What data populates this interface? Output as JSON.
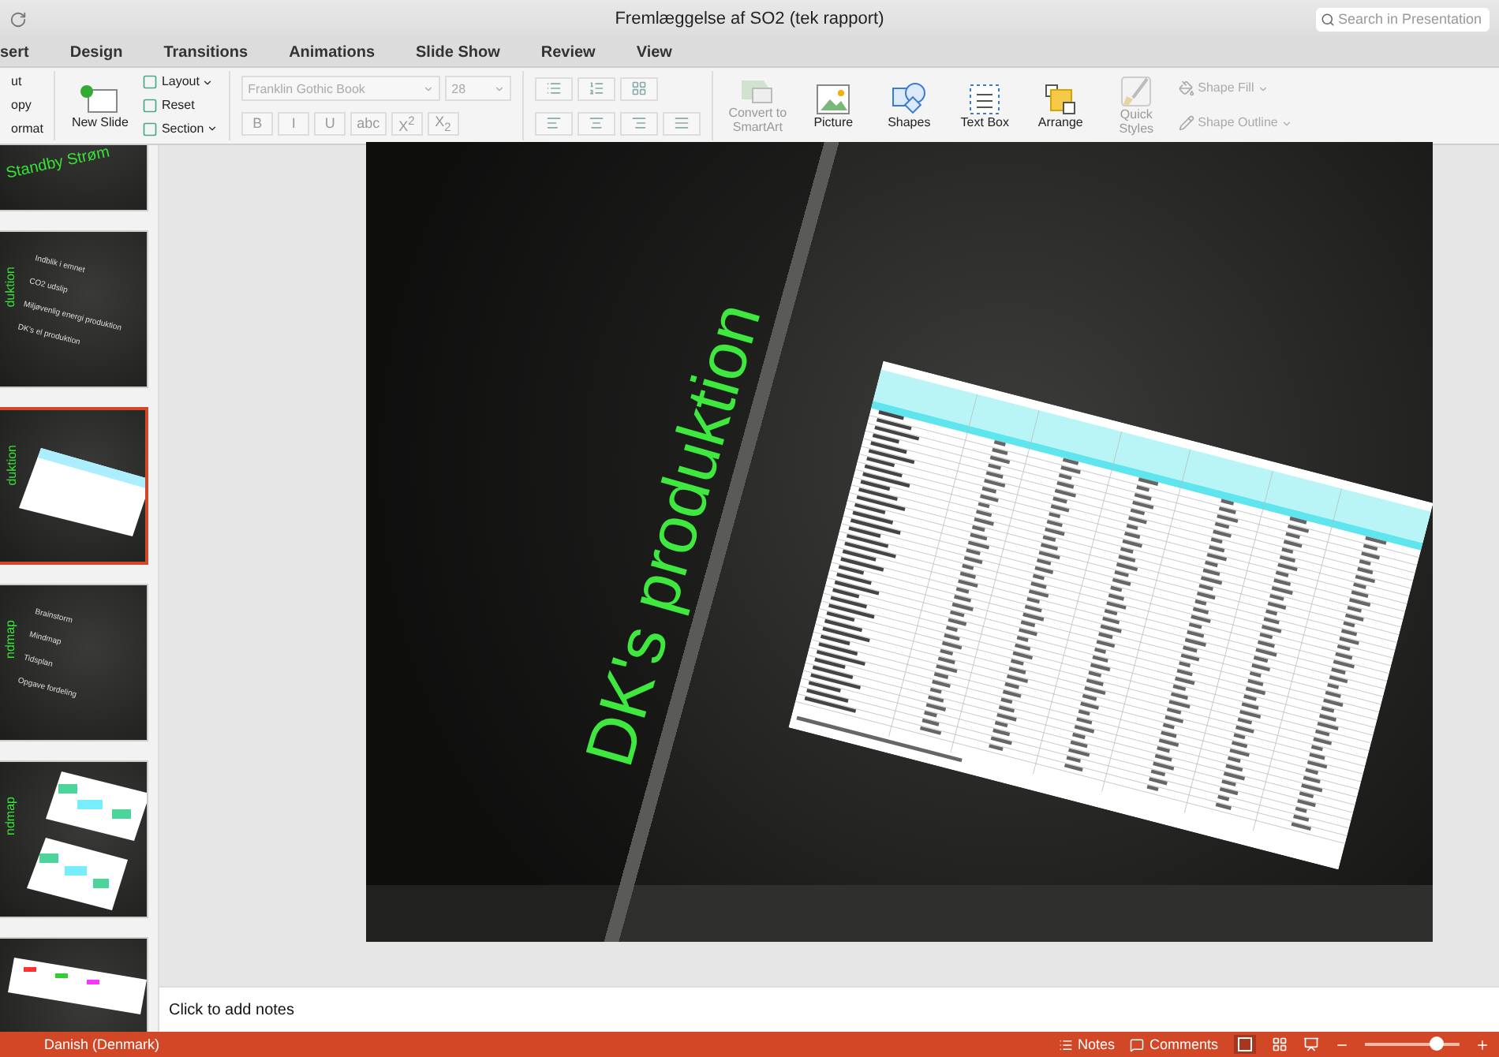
{
  "window": {
    "title": "Fremlæggelse af SO2 (tek rapport)",
    "search_placeholder": "Search in Presentation"
  },
  "tabs": [
    {
      "label": "sert"
    },
    {
      "label": "Design"
    },
    {
      "label": "Transitions"
    },
    {
      "label": "Animations"
    },
    {
      "label": "Slide Show"
    },
    {
      "label": "Review"
    },
    {
      "label": "View"
    }
  ],
  "ribbon": {
    "clipboard": [
      "ut",
      "opy",
      "ormat"
    ],
    "new_slide": "New Slide",
    "slide_commands": [
      {
        "label": "Layout",
        "menu": true
      },
      {
        "label": "Reset",
        "menu": false
      },
      {
        "label": "Section",
        "menu": true
      }
    ],
    "font_name": "Franklin Gothic Book",
    "font_size": "28",
    "format_buttons": [
      "B",
      "I",
      "U",
      "abc",
      "X$^{2}$",
      "X$_{2}$"
    ],
    "insert_buttons": [
      {
        "label": "Convert to SmartArt",
        "kind": "smartart",
        "disabled": true
      },
      {
        "label": "Picture",
        "kind": "picture",
        "disabled": false
      },
      {
        "label": "Shapes",
        "kind": "shapes",
        "disabled": false
      },
      {
        "label": "Text Box",
        "kind": "textbox",
        "disabled": false
      },
      {
        "label": "Arrange",
        "kind": "arrange",
        "disabled": false
      },
      {
        "label": "Quick Styles",
        "kind": "styles",
        "disabled": true
      }
    ],
    "shape_commands": [
      {
        "label": "Shape Fill",
        "kind": "fill"
      },
      {
        "label": "Shape Outline",
        "kind": "outline"
      }
    ]
  },
  "thumbnails": [
    {
      "kind": "title",
      "selected": false,
      "lines": [
        "Standby Strøm"
      ]
    },
    {
      "kind": "bullets",
      "selected": false,
      "side_text": "duktion",
      "lines": [
        "Indblik i emnet",
        "CO2 udslip",
        "Miljøvenlig energi produktion",
        "DK's el produktion"
      ]
    },
    {
      "kind": "table",
      "selected": true,
      "side_text": "duktion"
    },
    {
      "kind": "bullets",
      "selected": false,
      "side_text": "ndmap",
      "lines": [
        "Brainstorm",
        "Mindmap",
        "Tidsplan",
        "Opgave fordeling"
      ]
    },
    {
      "kind": "mindmap",
      "selected": false,
      "side_text": "ndmap"
    },
    {
      "kind": "chart",
      "selected": false
    }
  ],
  "slide": {
    "title": "DK's produktion",
    "content": {
      "kind": "table"
    }
  },
  "notes": {
    "placeholder": "Click to add notes"
  },
  "status_bar": {
    "language": "Danish (Denmark)",
    "notes": "Notes",
    "comments": "Comments",
    "zoom": {
      "level": 0.75
    }
  }
}
